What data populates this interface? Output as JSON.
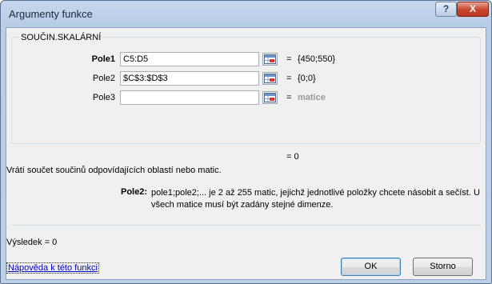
{
  "window": {
    "title": "Argumenty funkce",
    "help_button": "?",
    "close_button": "X"
  },
  "function_name": "SOUČIN.SKALÁRNÍ",
  "arguments": [
    {
      "label": "Pole1",
      "value": "C5:D5",
      "result": "{450;550}",
      "bold": true,
      "result_gray": false
    },
    {
      "label": "Pole2",
      "value": "$C$3:$D$3",
      "result": "{0;0}",
      "bold": false,
      "result_gray": false
    },
    {
      "label": "Pole3",
      "value": "",
      "result": "matice",
      "bold": false,
      "result_gray": true
    }
  ],
  "equals_sign": "=",
  "formula_result": "= 0",
  "description": "Vrátí součet součinů odpovídajících oblastí nebo matic.",
  "param_help": {
    "label": "Pole2:",
    "text": "pole1;pole2;... je 2 až 255 matic, jejichž jednotlivé položky chcete násobit a sečíst. U všech matice musí být zadány stejné dimenze."
  },
  "result_line": "Výsledek =  0",
  "help_link": "Nápověda k této funkci",
  "buttons": {
    "ok": "OK",
    "cancel": "Storno"
  },
  "icons": {
    "ref_button": "collapse-dialog-icon"
  }
}
